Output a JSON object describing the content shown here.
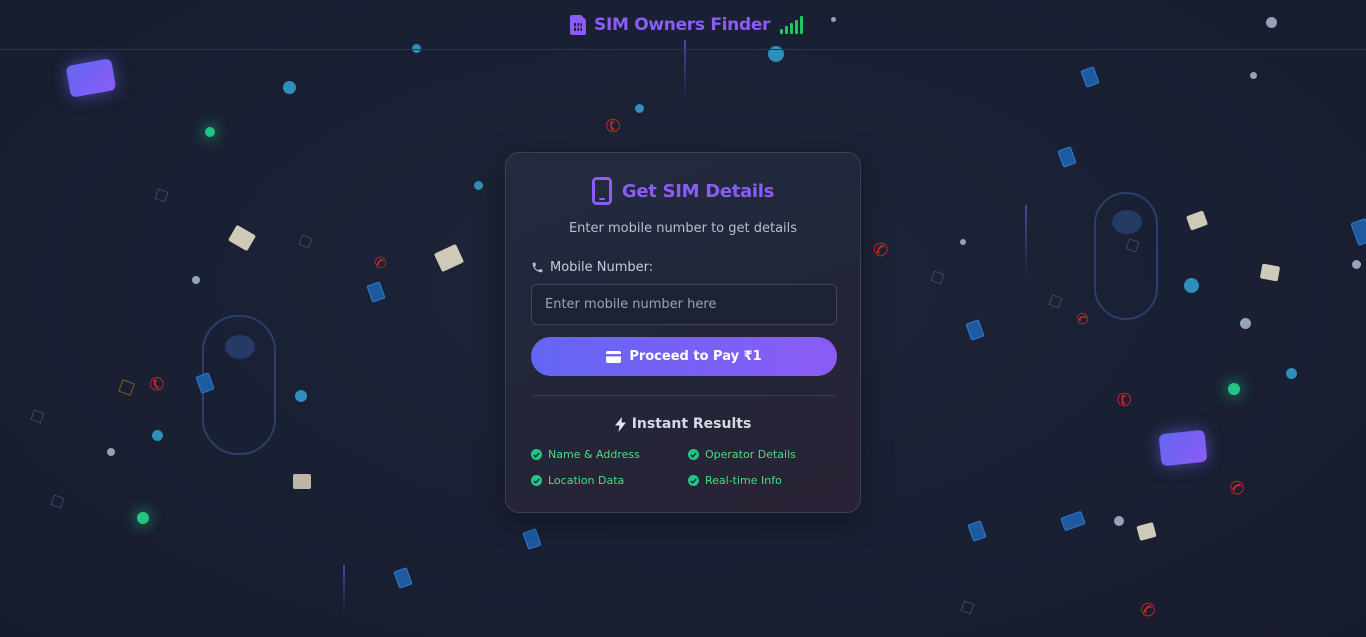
{
  "header": {
    "title": "SIM Owners Finder",
    "logo_icon": "sim-card-icon",
    "signal_icon": "signal-bars-icon"
  },
  "card": {
    "title": "Get SIM Details",
    "title_icon": "mobile-phone-icon",
    "subtitle": "Enter mobile number to get details",
    "field_label": "Mobile Number:",
    "field_label_icon": "phone-icon",
    "input": {
      "placeholder": "Enter mobile number here",
      "value": ""
    },
    "pay_button": {
      "label": "Proceed to Pay ₹1",
      "icon": "credit-card-icon"
    },
    "results": {
      "heading": "Instant Results",
      "heading_icon": "bolt-icon",
      "features": [
        "Name & Address",
        "Operator Details",
        "Location Data",
        "Real-time Info"
      ]
    }
  },
  "colors": {
    "background": "#1a2033",
    "accent": "#8b5cf6",
    "accent_start": "#6366f1",
    "success": "#22c583"
  }
}
